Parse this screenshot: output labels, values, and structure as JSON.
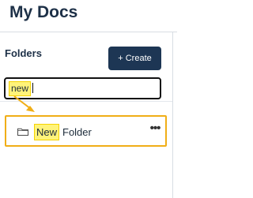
{
  "header": {
    "title": "My Docs"
  },
  "folders": {
    "title": "Folders",
    "create_label": "+ Create",
    "search_value": "new",
    "items": [
      {
        "highlight": "New",
        "rest": "Folder",
        "icon": "folder-icon",
        "menu": "•••"
      }
    ]
  },
  "annotation": {
    "highlight_color": "#fff37a",
    "outline_color": "#f0ae17"
  }
}
